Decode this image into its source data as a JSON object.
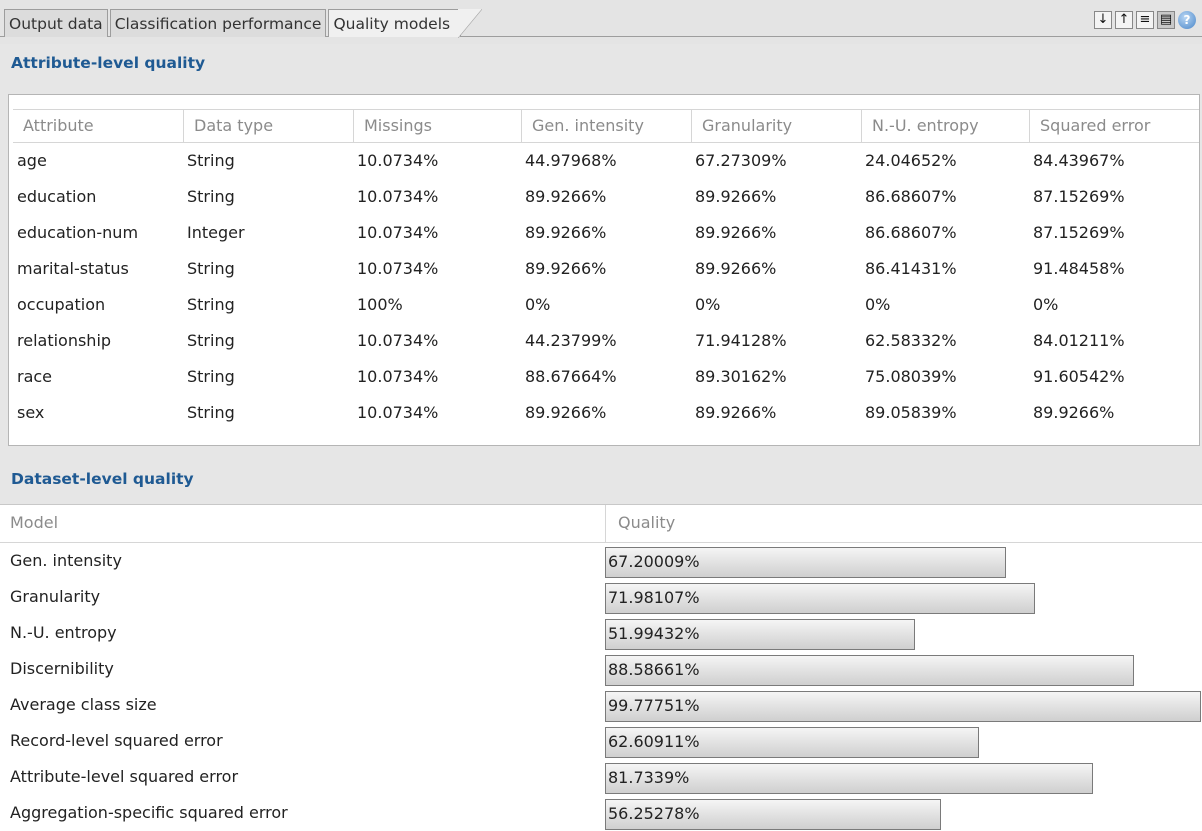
{
  "tabs": [
    "Output data",
    "Classification performance",
    "Quality models"
  ],
  "active_tab": "Quality models",
  "toolbar": {
    "icons": [
      "arrow-down-icon",
      "arrow-up-icon",
      "list-icon",
      "table-icon",
      "help-icon"
    ]
  },
  "attribute_section": {
    "title": "Attribute-level quality",
    "columns": [
      "Attribute",
      "Data type",
      "Missings",
      "Gen. intensity",
      "Granularity",
      "N.-U. entropy",
      "Squared error"
    ],
    "rows": [
      [
        "age",
        "String",
        "10.0734%",
        "44.97968%",
        "67.27309%",
        "24.04652%",
        "84.43967%"
      ],
      [
        "education",
        "String",
        "10.0734%",
        "89.9266%",
        "89.9266%",
        "86.68607%",
        "87.15269%"
      ],
      [
        "education-num",
        "Integer",
        "10.0734%",
        "89.9266%",
        "89.9266%",
        "86.68607%",
        "87.15269%"
      ],
      [
        "marital-status",
        "String",
        "10.0734%",
        "89.9266%",
        "89.9266%",
        "86.41431%",
        "91.48458%"
      ],
      [
        "occupation",
        "String",
        "100%",
        "0%",
        "0%",
        "0%",
        "0%"
      ],
      [
        "relationship",
        "String",
        "10.0734%",
        "44.23799%",
        "71.94128%",
        "62.58332%",
        "84.01211%"
      ],
      [
        "race",
        "String",
        "10.0734%",
        "88.67664%",
        "89.30162%",
        "75.08039%",
        "91.60542%"
      ],
      [
        "sex",
        "String",
        "10.0734%",
        "89.9266%",
        "89.9266%",
        "89.05839%",
        "89.9266%"
      ]
    ]
  },
  "dataset_section": {
    "title": "Dataset-level quality",
    "columns": [
      "Model",
      "Quality"
    ],
    "rows": [
      {
        "model": "Gen. intensity",
        "quality": "67.20009%",
        "value": 0.6720009
      },
      {
        "model": "Granularity",
        "quality": "71.98107%",
        "value": 0.7198107
      },
      {
        "model": "N.-U. entropy",
        "quality": "51.99432%",
        "value": 0.5199432
      },
      {
        "model": "Discernibility",
        "quality": "88.58661%",
        "value": 0.8858661
      },
      {
        "model": "Average class size",
        "quality": "99.77751%",
        "value": 0.9977751
      },
      {
        "model": "Record-level squared error",
        "quality": "62.60911%",
        "value": 0.6260911
      },
      {
        "model": "Attribute-level squared error",
        "quality": "81.7339%",
        "value": 0.817339
      },
      {
        "model": "Aggregation-specific squared error",
        "quality": "56.25278%",
        "value": 0.5625278
      }
    ]
  }
}
